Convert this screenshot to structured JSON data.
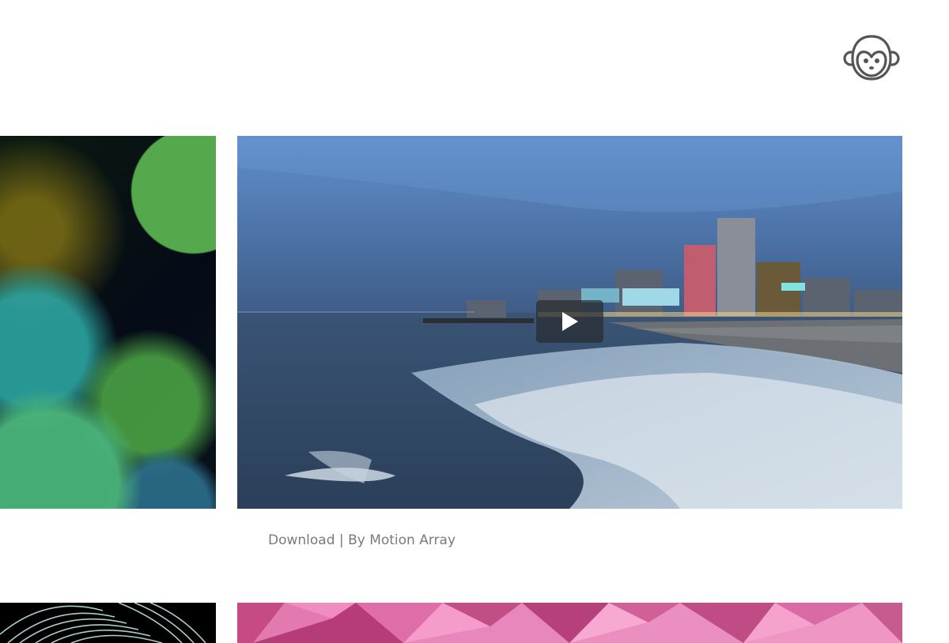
{
  "header": {
    "logo_icon": "monkey-face-icon"
  },
  "gallery": {
    "featured": {
      "play_icon": "play-icon",
      "credit_link": "Download",
      "credit_separator": " | ",
      "credit_by": "By Motion Array"
    }
  },
  "colors": {
    "credit_text": "#7a7a7a",
    "logo_stroke": "#555555"
  }
}
